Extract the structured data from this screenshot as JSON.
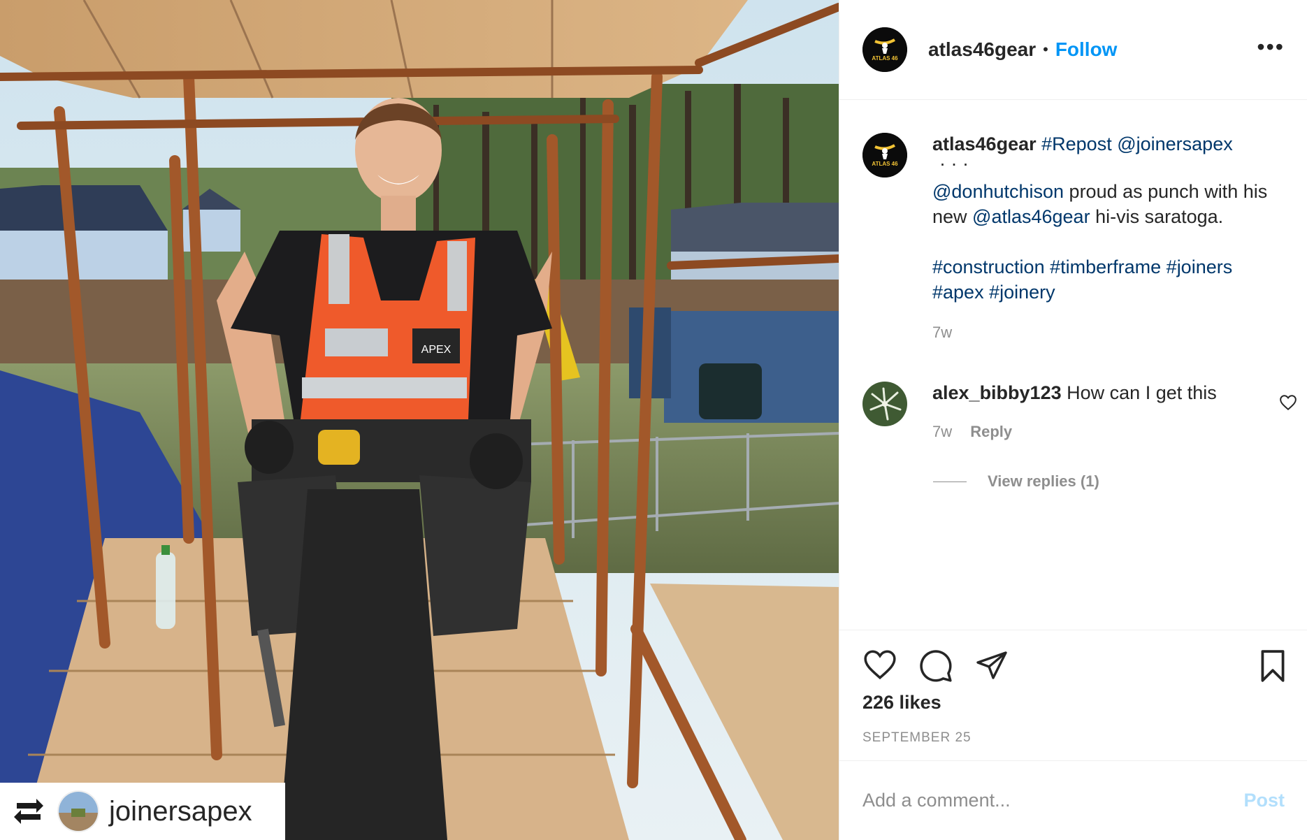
{
  "post": {
    "image_alt": "",
    "repost_credit": {
      "username": "joinersapex",
      "icon": "repost-icon"
    }
  },
  "header": {
    "username": "atlas46gear",
    "separator": "•",
    "follow_label": "Follow",
    "more_icon": "more-options-icon",
    "avatar_logo_text": "ATLAS 46"
  },
  "caption": {
    "username": "atlas46gear",
    "repost_tag": "#Repost",
    "repost_mention": "@joinersapex",
    "dots": "·  ·  ·",
    "mention_user": "@donhutchison",
    "text_1": " proud as punch with his new ",
    "mention_brand": "@atlas46gear",
    "text_2": " hi-vis saratoga.",
    "hashtags_line1": [
      "#construction",
      "#timberframe",
      "#joiners"
    ],
    "hashtags_line2": [
      "#apex",
      "#joinery"
    ],
    "timestamp": "7w"
  },
  "comments": [
    {
      "username": "alex_bibby123",
      "text": "How can I get this",
      "timestamp": "7w",
      "reply_label": "Reply",
      "view_replies_label": "View replies (1)"
    }
  ],
  "actions": {
    "icons": [
      "heart-icon",
      "comment-icon",
      "share-icon",
      "bookmark-icon"
    ]
  },
  "likes": "226 likes",
  "date": "SEPTEMBER 25",
  "add_comment": {
    "placeholder": "Add a comment...",
    "post_label": "Post"
  },
  "colors": {
    "link": "#00376b",
    "follow": "#0095f6",
    "muted": "#8e8e8e",
    "post_disabled": "#b2dffc"
  }
}
